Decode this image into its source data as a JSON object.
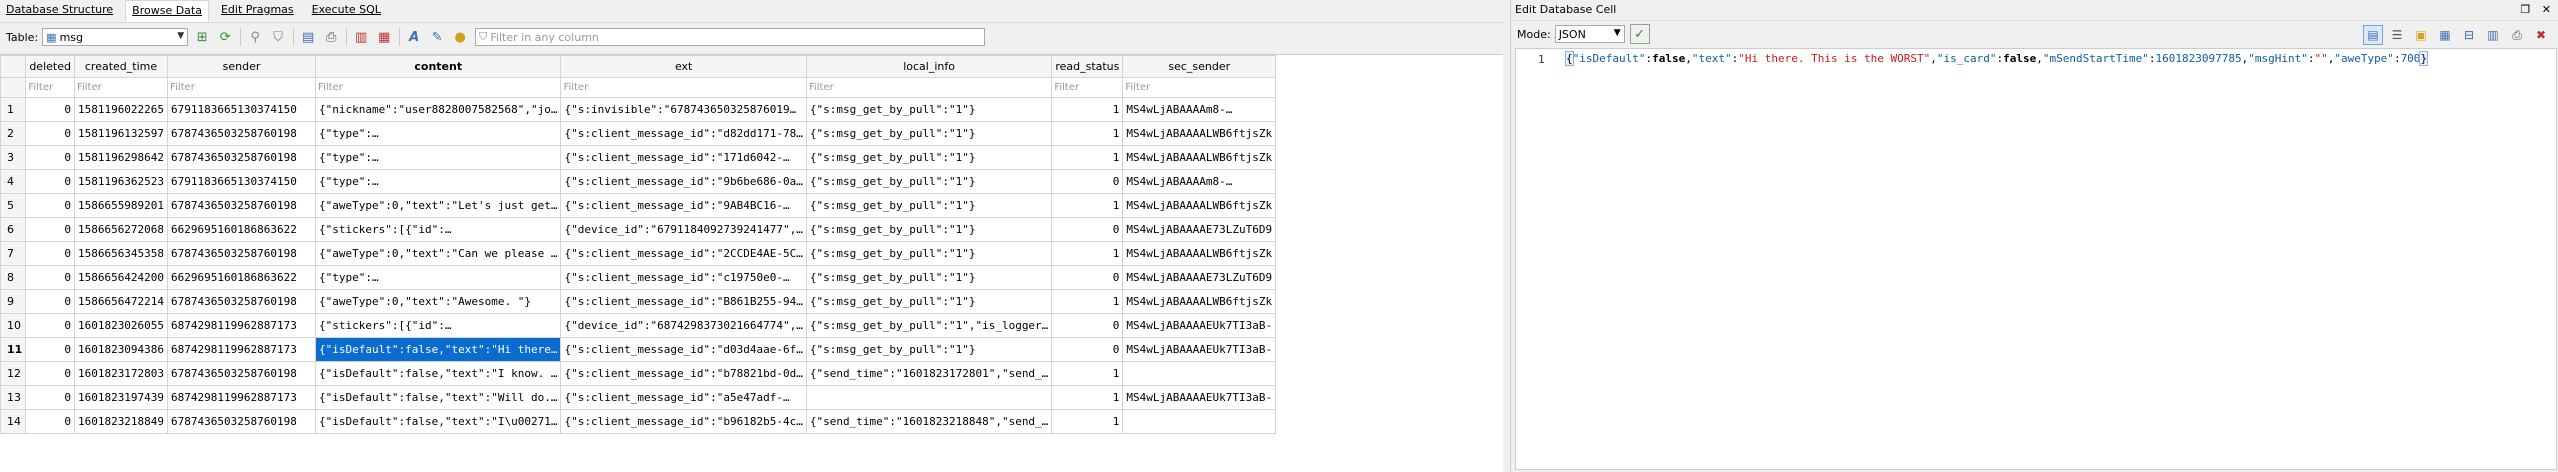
{
  "tabs": [
    "Database Structure",
    "Browse Data",
    "Edit Pragmas",
    "Execute SQL"
  ],
  "table_label": "Table:",
  "table_selected": "msg",
  "filter_all_placeholder": "Filter in any column",
  "filter_placeholder": "Filter",
  "columns": [
    "deleted",
    "created_time",
    "sender",
    "content",
    "ext",
    "local_info",
    "read_status",
    "sec_sender"
  ],
  "rows": [
    {
      "n": "1",
      "deleted": "0",
      "created_time": "1581196022265",
      "sender": "6791183665130374150",
      "content": "{\"nickname\":\"user8828007582568\",\"jo…",
      "ext": "{\"s:invisible\":\"678743650325876019…",
      "local_info": "{\"s:msg_get_by_pull\":\"1\"}",
      "read_status": "1",
      "sec_sender": "MS4wLjABAAAAm8-…"
    },
    {
      "n": "2",
      "deleted": "0",
      "created_time": "1581196132597",
      "sender": "6787436503258760198",
      "content": "{\"type\":…",
      "ext": "{\"s:client_message_id\":\"d82dd171-78…",
      "local_info": "{\"s:msg_get_by_pull\":\"1\"}",
      "read_status": "1",
      "sec_sender": "MS4wLjABAAAALWB6ftjsZk"
    },
    {
      "n": "3",
      "deleted": "0",
      "created_time": "1581196298642",
      "sender": "6787436503258760198",
      "content": "{\"type\":…",
      "ext": "{\"s:client_message_id\":\"171d6042-…",
      "local_info": "{\"s:msg_get_by_pull\":\"1\"}",
      "read_status": "1",
      "sec_sender": "MS4wLjABAAAALWB6ftjsZk"
    },
    {
      "n": "4",
      "deleted": "0",
      "created_time": "1581196362523",
      "sender": "6791183665130374150",
      "content": "{\"type\":…",
      "ext": "{\"s:client_message_id\":\"9b6be686-0a…",
      "local_info": "{\"s:msg_get_by_pull\":\"1\"}",
      "read_status": "0",
      "sec_sender": "MS4wLjABAAAAm8-…"
    },
    {
      "n": "5",
      "deleted": "0",
      "created_time": "1586655989201",
      "sender": "6787436503258760198",
      "content": "{\"aweType\":0,\"text\":\"Let's just get…",
      "ext": "{\"s:client_message_id\":\"9AB4BC16-…",
      "local_info": "{\"s:msg_get_by_pull\":\"1\"}",
      "read_status": "1",
      "sec_sender": "MS4wLjABAAAALWB6ftjsZk"
    },
    {
      "n": "6",
      "deleted": "0",
      "created_time": "1586656272068",
      "sender": "6629695160186863622",
      "content": "{\"stickers\":[{\"id\":…",
      "ext": "{\"device_id\":\"6791184092739241477\",…",
      "local_info": "{\"s:msg_get_by_pull\":\"1\"}",
      "read_status": "0",
      "sec_sender": "MS4wLjABAAAAE73LZuT6D9"
    },
    {
      "n": "7",
      "deleted": "0",
      "created_time": "1586656345358",
      "sender": "6787436503258760198",
      "content": "{\"aweType\":0,\"text\":\"Can we please …",
      "ext": "{\"s:client_message_id\":\"2CCDE4AE-5C…",
      "local_info": "{\"s:msg_get_by_pull\":\"1\"}",
      "read_status": "1",
      "sec_sender": "MS4wLjABAAAALWB6ftjsZk"
    },
    {
      "n": "8",
      "deleted": "0",
      "created_time": "1586656424200",
      "sender": "6629695160186863622",
      "content": "{\"type\":…",
      "ext": "{\"s:client_message_id\":\"c19750e0-…",
      "local_info": "{\"s:msg_get_by_pull\":\"1\"}",
      "read_status": "0",
      "sec_sender": "MS4wLjABAAAAE73LZuT6D9"
    },
    {
      "n": "9",
      "deleted": "0",
      "created_time": "1586656472214",
      "sender": "6787436503258760198",
      "content": "{\"aweType\":0,\"text\":\"Awesome. \"}",
      "ext": "{\"s:client_message_id\":\"B861B255-94…",
      "local_info": "{\"s:msg_get_by_pull\":\"1\"}",
      "read_status": "1",
      "sec_sender": "MS4wLjABAAAALWB6ftjsZk"
    },
    {
      "n": "10",
      "deleted": "0",
      "created_time": "1601823026055",
      "sender": "6874298119962887173",
      "content": "{\"stickers\":[{\"id\":…",
      "ext": "{\"device_id\":\"6874298373021664774\",…",
      "local_info": "{\"s:msg_get_by_pull\":\"1\",\"is_logger…",
      "read_status": "0",
      "sec_sender": "MS4wLjABAAAAEUk7TI3aB-"
    },
    {
      "n": "11",
      "deleted": "0",
      "created_time": "1601823094386",
      "sender": "6874298119962887173",
      "content": "{\"isDefault\":false,\"text\":\"Hi there…",
      "ext": "{\"s:client_message_id\":\"d03d4aae-6f…",
      "local_info": "{\"s:msg_get_by_pull\":\"1\"}",
      "read_status": "0",
      "sec_sender": "MS4wLjABAAAAEUk7TI3aB-"
    },
    {
      "n": "12",
      "deleted": "0",
      "created_time": "1601823172803",
      "sender": "6787436503258760198",
      "content": "{\"isDefault\":false,\"text\":\"I know. …",
      "ext": "{\"s:client_message_id\":\"b78821bd-0d…",
      "local_info": "{\"send_time\":\"1601823172801\",\"send_…",
      "read_status": "1",
      "sec_sender": ""
    },
    {
      "n": "13",
      "deleted": "0",
      "created_time": "1601823197439",
      "sender": "6874298119962887173",
      "content": "{\"isDefault\":false,\"text\":\"Will do.…",
      "ext": "{\"s:client_message_id\":\"a5e47adf-…",
      "local_info": "",
      "read_status": "1",
      "sec_sender": "MS4wLjABAAAAEUk7TI3aB-"
    },
    {
      "n": "14",
      "deleted": "0",
      "created_time": "1601823218849",
      "sender": "6787436503258760198",
      "content": "{\"isDefault\":false,\"text\":\"I\\u00271…",
      "ext": "{\"s:client_message_id\":\"b96182b5-4c…",
      "local_info": "{\"send_time\":\"1601823218848\",\"send_…",
      "read_status": "1",
      "sec_sender": ""
    }
  ],
  "selected_row": "11",
  "right_panel": {
    "title": "Edit Database Cell",
    "mode_label": "Mode:",
    "mode_value": "JSON",
    "line_number": "1",
    "code": {
      "open": "{",
      "k1": "\"isDefault\"",
      "v1": "false",
      "k2": "\"text\"",
      "v2": "\"Hi there. This is the WORST\"",
      "k3": "\"is_card\"",
      "v3": "false",
      "k4": "\"mSendStartTime\"",
      "v4": "1601823097785",
      "k5": "\"msgHint\"",
      "v5": "\"\"",
      "k6": "\"aweType\"",
      "v6": "700",
      "close": "}"
    }
  }
}
